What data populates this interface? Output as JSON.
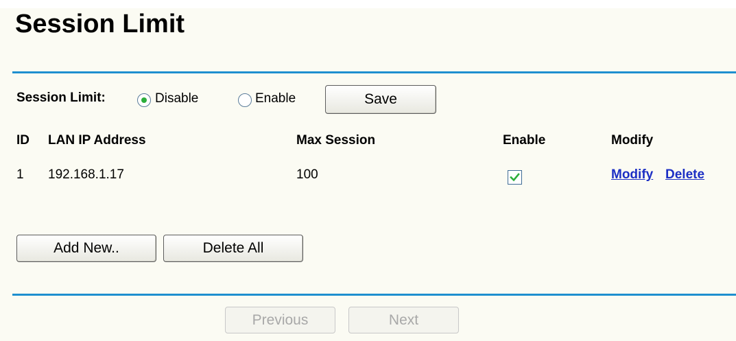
{
  "page": {
    "title": "Session Limit"
  },
  "session_limit": {
    "label": "Session Limit:",
    "options": [
      {
        "label": "Disable",
        "selected": true
      },
      {
        "label": "Enable",
        "selected": false
      }
    ],
    "save_label": "Save"
  },
  "table": {
    "headers": [
      "ID",
      "LAN IP Address",
      "Max Session",
      "Enable",
      "Modify"
    ],
    "rows": [
      {
        "id": "1",
        "lan_ip": "192.168.1.17",
        "max_session": "100",
        "enabled": true,
        "modify_label": "Modify",
        "delete_label": "Delete"
      }
    ]
  },
  "actions": {
    "add_new_label": "Add New..",
    "delete_all_label": "Delete All"
  },
  "pagination": {
    "previous_label": "Previous",
    "next_label": "Next"
  },
  "colors": {
    "rule": "#1e8fcf",
    "link": "#1c2fc4",
    "radio_selected": "#2cae3b",
    "check": "#2cae3b",
    "background": "#fbfbf3"
  },
  "icons": {
    "checkbox_mark": "checkmark-icon"
  }
}
